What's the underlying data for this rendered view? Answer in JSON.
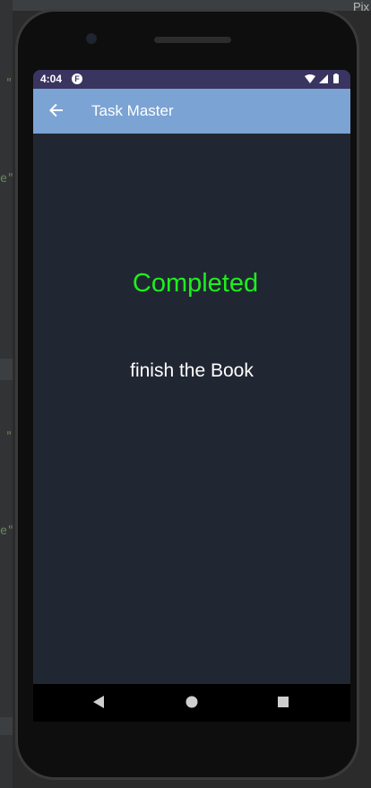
{
  "ide": {
    "pix_label": "Pix",
    "gutter_marks": [
      "\"",
      "e\"",
      "\"",
      "e\""
    ]
  },
  "status_bar": {
    "time": "4:04",
    "app_icon": "notification-app-icon",
    "icons": [
      "wifi-icon",
      "signal-icon",
      "battery-icon"
    ],
    "background": "#3a3460"
  },
  "app_bar": {
    "title": "Task Master",
    "back_icon": "arrow-back-icon",
    "background": "#7ba3d3"
  },
  "main": {
    "status": "Completed",
    "status_color": "#1eef1e",
    "task_title": "finish the Book",
    "background": "#212732"
  },
  "nav_bar": {
    "buttons": [
      "back-triangle-icon",
      "home-circle-icon",
      "recents-square-icon"
    ]
  }
}
